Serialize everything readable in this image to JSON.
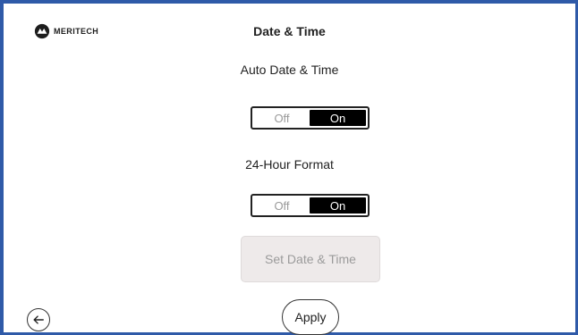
{
  "brand": {
    "logo_text": "MERITECH",
    "logo_icon": "meritech-logo-icon"
  },
  "page": {
    "title": "Date & Time"
  },
  "auto_date_time": {
    "label": "Auto Date & Time",
    "off_label": "Off",
    "on_label": "On",
    "selected": "On"
  },
  "hour_format": {
    "label": "24-Hour Format",
    "off_label": "Off",
    "on_label": "On",
    "selected": "On"
  },
  "set_date_time": {
    "label": "Set Date & Time",
    "disabled": true
  },
  "apply": {
    "label": "Apply"
  },
  "back": {
    "icon": "arrow-left-icon"
  },
  "colors": {
    "frame_border": "#2f5aa8",
    "toggle_on_bg": "#000000",
    "disabled_button_bg": "#eeeaea"
  }
}
